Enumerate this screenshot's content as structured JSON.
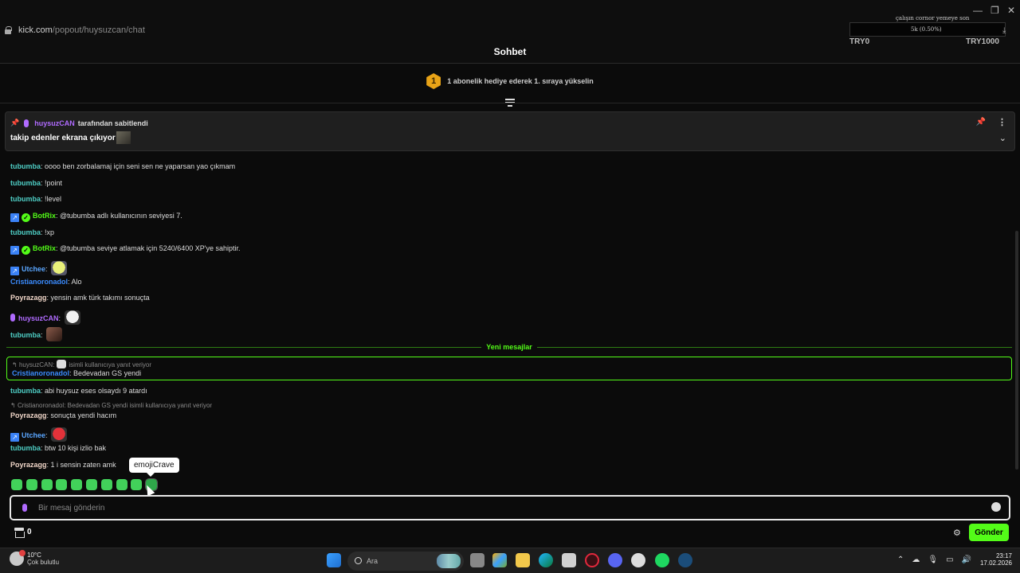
{
  "browser": {
    "url_domain": "kick.com",
    "url_path": "/popout/huysuzcan/chat"
  },
  "overlay_widget": {
    "title": "çalışın cornor yemeye son",
    "progress_text": "5k (0.50%)",
    "low_label": "TRY0",
    "high_label": "TRY1000"
  },
  "chat": {
    "title": "Sohbet",
    "gift_rank": "1",
    "gift_text": "1 abonelik hediye ederek 1. sıraya yükselin",
    "pinned": {
      "user": "huysuzCAN",
      "by_text": "tarafından sabitlendi",
      "message": "takip edenler ekrana çıkıyor"
    },
    "messages": [
      {
        "user": "tubumba",
        "text": "oooo ben zorbalamaj için seni sen ne yaparsan yao çıkmam"
      },
      {
        "user": "tubumba",
        "text": "!point"
      },
      {
        "user": "tubumba",
        "text": "!level"
      },
      {
        "user": "BotRix",
        "text": "@tubumba adlı kullanıcının seviyesi 7."
      },
      {
        "user": "tubumba",
        "text": "!xp"
      },
      {
        "user": "BotRix",
        "text": "@tubumba seviye atlamak için 5240/6400 XP'ye sahiptir."
      },
      {
        "user": "Utchee",
        "text": ""
      },
      {
        "user": "Cristianoronadol",
        "text": "Alo"
      },
      {
        "user": "Poyrazagg",
        "text": "yensin amk türk takımı sonuçta"
      },
      {
        "user": "huysuzCAN",
        "text": ""
      },
      {
        "user": "tubumba",
        "text": ""
      }
    ],
    "new_messages_label": "Yeni mesajlar",
    "reply_highlight": {
      "ref_user": "huysuzCAN:",
      "ref_text": "isimli kullanıcıya yanıt veriyor",
      "user": "Cristianoronadol",
      "text": "Bedevadan GS yendi"
    },
    "messages_after": [
      {
        "user": "tubumba",
        "text": "abi huysuz eses olsaydı 9 atardı"
      },
      {
        "user": "Poyrazagg",
        "text": "sonuçta yendi hacım",
        "reply_ref": "Cristianoronadol: Bedevadan GS yendi isimli kullanıcıya yanıt veriyor"
      },
      {
        "user": "Utchee",
        "text": ""
      },
      {
        "user": "tubumba",
        "text": "btw 10 kişi izlio bak"
      },
      {
        "user": "Poyrazagg",
        "text": "1 i sensin zaten amk"
      }
    ],
    "tooltip": "emojiCrave",
    "input_placeholder": "Bir mesaj gönderin",
    "points": "0",
    "send_label": "Gönder"
  },
  "taskbar": {
    "temp": "10°C",
    "weather": "Çok bulutlu",
    "search_label": "Ara",
    "time": "23:17",
    "date": "17.02.2026"
  },
  "colors": {
    "accent": "#53fc18",
    "background": "#0b0b0b",
    "user_tubumba": "#4ecdc4",
    "user_botrix": "#53fc18",
    "user_utchee": "#5aa6ff",
    "user_cristianoronadol": "#3b8cff",
    "user_poyrazagg": "#f0d6c8",
    "user_huysuzcan": "#b06bff"
  }
}
